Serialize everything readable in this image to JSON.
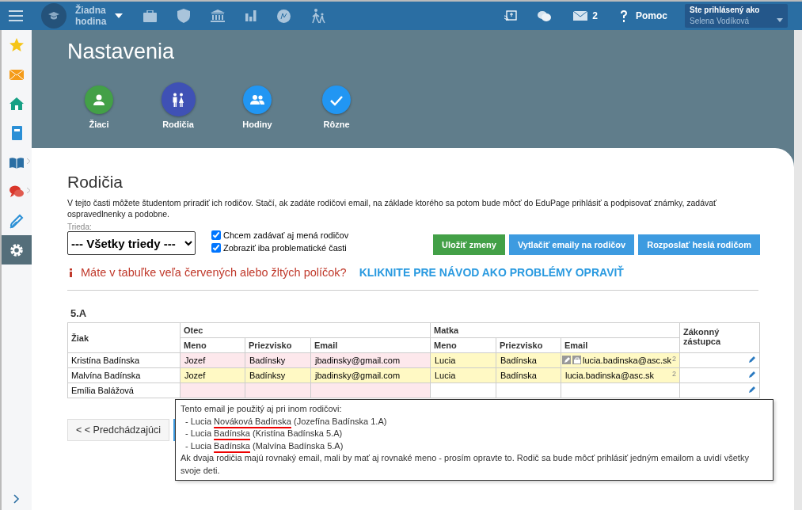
{
  "topbar": {
    "lesson": "Žiadna hodina",
    "mail_count": "2",
    "help": "Pomoc",
    "login_label": "Ste prihlásený ako",
    "user": "Selena Vodíková"
  },
  "sidebar": {
    "items": [
      {
        "kind": "star",
        "selected": false
      },
      {
        "kind": "mail",
        "selected": false
      },
      {
        "kind": "home",
        "selected": false
      },
      {
        "kind": "notebook",
        "selected": false
      },
      {
        "kind": "book",
        "selected": false
      },
      {
        "kind": "chat",
        "selected": false
      },
      {
        "kind": "pen",
        "selected": false
      },
      {
        "kind": "gear",
        "selected": true
      }
    ]
  },
  "page_title": "Nastavenia",
  "sections": [
    {
      "label": "Žiaci",
      "kind": "student",
      "color": "#43a047",
      "selected": false
    },
    {
      "label": "Rodičia",
      "kind": "parents",
      "color": "#3f51b5",
      "selected": true
    },
    {
      "label": "Hodiny",
      "kind": "group",
      "color": "#2196f3",
      "selected": false
    },
    {
      "label": "Rôzne",
      "kind": "check",
      "color": "#2196f3",
      "selected": false
    }
  ],
  "card": {
    "title": "Rodičia",
    "description": "V tejto časti môžete študentom priradiť ich rodičov. Stačí, ak zadáte rodičovi email, na základe ktorého sa potom bude môcť do EduPage prihlásiť a podpisovať známky, zadávať ospravedlnenky a podobne.",
    "class_label": "Trieda:",
    "class_value": "--- Všetky triedy ---",
    "options": [
      {
        "label": "Chcem zadávať aj mená rodičov",
        "checked": true
      },
      {
        "label": "Zobraziť iba problematické časti",
        "checked": true
      }
    ],
    "buttons": [
      {
        "label": "Uložiť zmeny",
        "kind": "save"
      },
      {
        "label": "Vytlačiť emaily na rodičov",
        "kind": "action"
      },
      {
        "label": "Rozposlať heslá rodičom",
        "kind": "action"
      }
    ],
    "warning": "Máte v tabuľke veľa červených alebo žltých políčok?",
    "help_link": "KLIKNITE PRE NÁVOD AKO PROBLÉMY OPRAVIŤ"
  },
  "table": {
    "class_name": "5.A",
    "student_header": "Žiak",
    "father_header": "Otec",
    "mother_header": "Matka",
    "guardian_header": "Zákonný zástupca",
    "columns": [
      "Meno",
      "Priezvisko",
      "Email",
      "Meno",
      "Priezvisko",
      "Email"
    ],
    "rows": [
      {
        "student": "Kristína Badínska",
        "cells": [
          {
            "text": "Jozef",
            "color": "#fde8ec"
          },
          {
            "text": "Badínsky",
            "color": "#fde8ec"
          },
          {
            "text": "jbadinsky@gmail.com",
            "color": "#fde8ec"
          },
          {
            "text": "Lucia",
            "color": "#fff9c4"
          },
          {
            "text": "Badínska",
            "color": "#fff9c4"
          },
          {
            "text": "lucia.badinska@asc.sk",
            "color": "#fff9c4",
            "count": "2",
            "hover": true
          }
        ]
      },
      {
        "student": "Malvína Badínska",
        "cells": [
          {
            "text": "Jozef",
            "color": "#fff9c4"
          },
          {
            "text": "Badínksy",
            "color": "#fff9c4"
          },
          {
            "text": "jbadinsky@gmail.com",
            "color": "#fff9c4"
          },
          {
            "text": "Lucia",
            "color": "#fff9c4"
          },
          {
            "text": "Badínska",
            "color": "#fff9c4"
          },
          {
            "text": "lucia.badinska@asc.sk",
            "color": "#fff9c4",
            "count": "2",
            "hover": false
          }
        ]
      },
      {
        "student": "Emília Balážová",
        "cells": [
          {
            "color": "#fde8ec"
          },
          {
            "color": "#fde8ec"
          },
          {
            "color": "#fde8ec"
          },
          {
            "color": "#ffffff"
          },
          {
            "color": "#ffffff"
          },
          {
            "color": "#ffffff"
          }
        ]
      }
    ]
  },
  "prev_button": "< < Predchádzajúci",
  "tooltip": {
    "heading": "Tento email je použitý aj pri inom rodičovi:",
    "lines": [
      {
        "prefix": "- Lucia",
        "name": "Nováková Badínska",
        "suffix": "(Jozefína Badínska 1.A)"
      },
      {
        "prefix": "- Lucia",
        "name": "Badínska",
        "suffix": "(Kristína Badínska 5.A)"
      },
      {
        "prefix": "- Lucia",
        "name": "Badínska",
        "suffix": "(Malvína Badínska 5.A)"
      }
    ],
    "note": "Ak dvaja rodičia majú rovnaký email, mali by mať aj rovnaké meno - prosím opravte to. Rodič sa bude môcť prihlásiť jedným emailom a uvidí všetky svoje deti."
  }
}
